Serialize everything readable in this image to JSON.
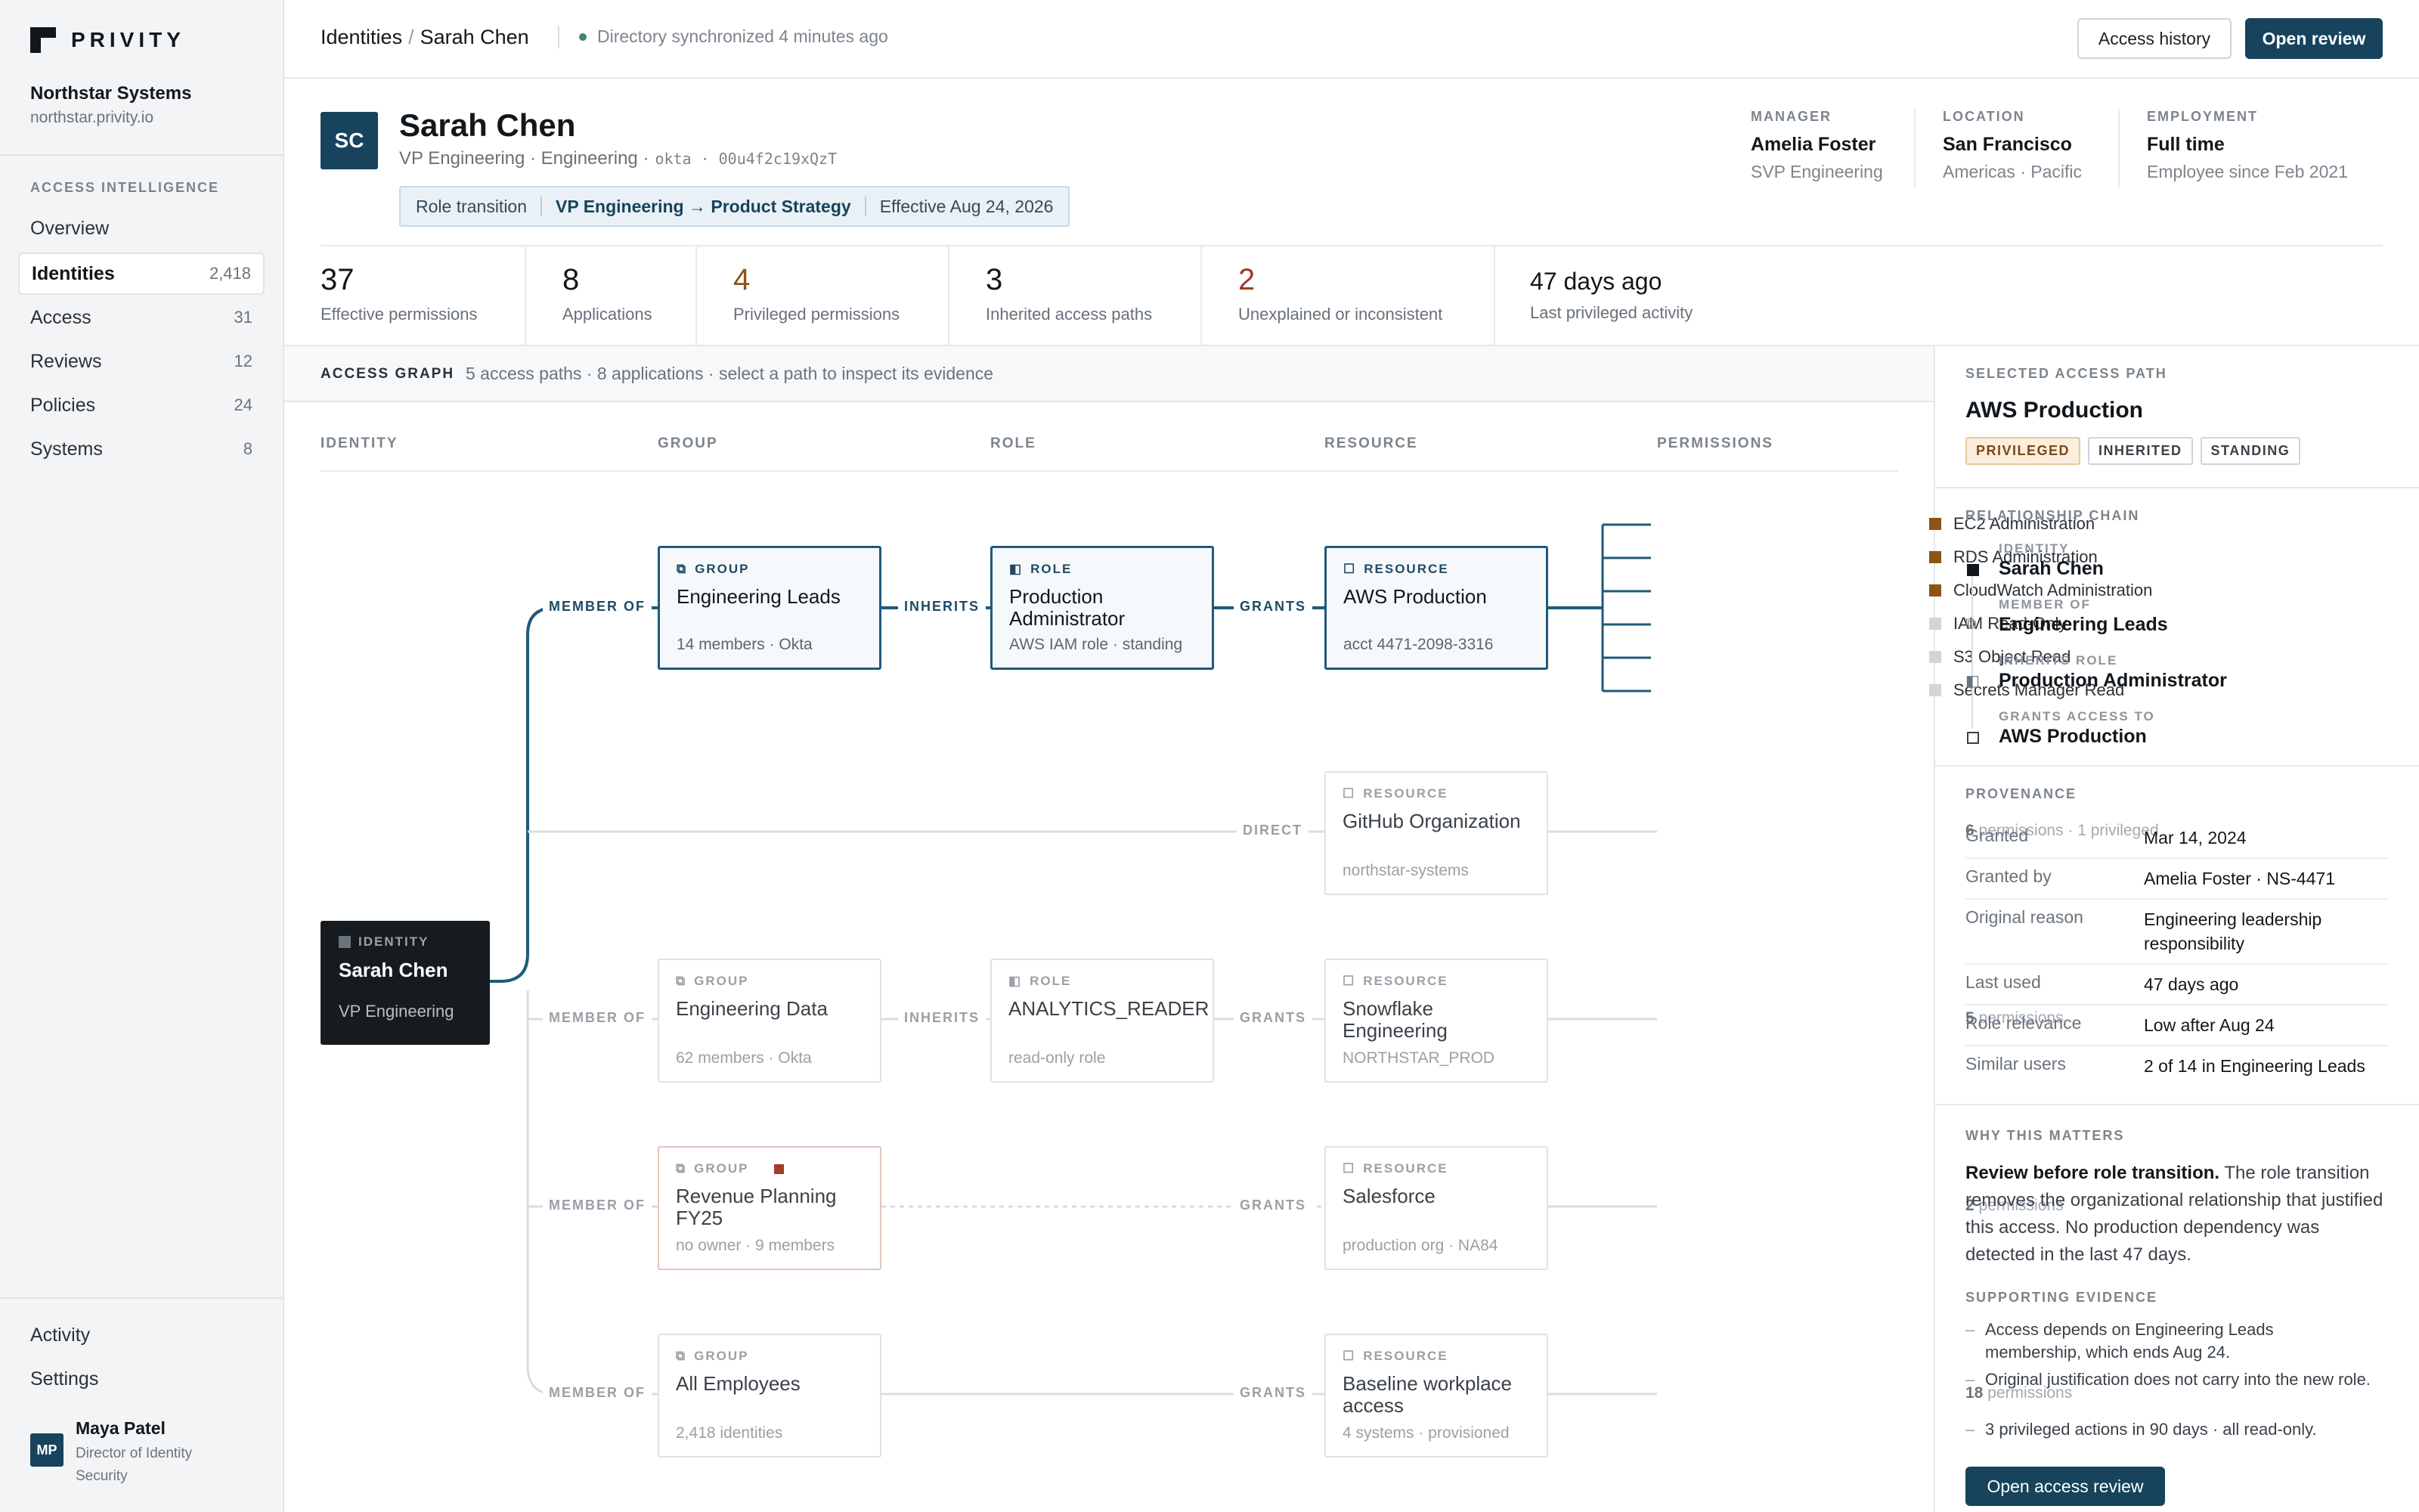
{
  "brand": {
    "name": "PRIVITY"
  },
  "org": {
    "name": "Northstar Systems",
    "domain": "northstar.privity.io"
  },
  "sidebar": {
    "section": "ACCESS INTELLIGENCE",
    "items": [
      {
        "label": "Overview",
        "count": ""
      },
      {
        "label": "Identities",
        "count": "2,418"
      },
      {
        "label": "Access",
        "count": "31"
      },
      {
        "label": "Reviews",
        "count": "12"
      },
      {
        "label": "Policies",
        "count": "24"
      },
      {
        "label": "Systems",
        "count": "8"
      }
    ],
    "bottom": [
      "Activity",
      "Settings"
    ],
    "user": {
      "initials": "MP",
      "name": "Maya Patel",
      "title": "Director of Identity Security"
    }
  },
  "header": {
    "crumb_root": "Identities",
    "crumb_sep": "/",
    "crumb_current": "Sarah Chen",
    "sync_status": "Directory synchronized 4 minutes ago",
    "access_history_label": "Access history",
    "open_review_label": "Open review"
  },
  "profile": {
    "initials": "SC",
    "name": "Sarah Chen",
    "title": "VP Engineering · Engineering ·",
    "source": "okta",
    "dot": "·",
    "id": "00u4f2c19xQzT",
    "transition_label": "Role transition",
    "transition_path": "VP Engineering → Product Strategy",
    "transition_effective": "Effective Aug 24, 2026",
    "facts": [
      {
        "key": "MANAGER",
        "value": "Amelia Foster",
        "sub": "SVP Engineering"
      },
      {
        "key": "LOCATION",
        "value": "San Francisco",
        "sub": "Americas · Pacific"
      },
      {
        "key": "EMPLOYMENT",
        "value": "Full time",
        "sub": "Employee since Feb 2021"
      }
    ]
  },
  "stats": [
    {
      "value": "37",
      "label": "Effective permissions",
      "color": "#12171c"
    },
    {
      "value": "8",
      "label": "Applications",
      "color": "#12171c"
    },
    {
      "value": "4",
      "label": "Privileged permissions",
      "color": "#8a5516"
    },
    {
      "value": "3",
      "label": "Inherited access paths",
      "color": "#12171c"
    },
    {
      "value": "2",
      "label": "Unexplained or inconsistent",
      "color": "#a33a2a"
    },
    {
      "value": "47 days ago",
      "label": "Last privileged activity",
      "color": "#12171c"
    }
  ],
  "graph": {
    "title": "ACCESS GRAPH",
    "summary": "5 access paths · 8 applications · select a path to inspect its evidence",
    "columns": [
      "IDENTITY",
      "GROUP",
      "ROLE",
      "RESOURCE",
      "PERMISSIONS"
    ],
    "identity": {
      "type": "IDENTITY",
      "name": "Sarah Chen",
      "sub": "VP Engineering"
    },
    "edges": {
      "member_of": "MEMBER OF",
      "inherits": "INHERITS",
      "grants": "GRANTS",
      "direct": "DIRECT"
    },
    "path1": {
      "group": {
        "type": "GROUP",
        "name": "Engineering Leads",
        "sub": "14 members · Okta"
      },
      "role": {
        "type": "ROLE",
        "name": "Production Administrator",
        "sub": "AWS IAM role · standing"
      },
      "resource": {
        "type": "RESOURCE",
        "name": "AWS Production",
        "sub": "acct 4471-2098-3316"
      },
      "permissions": [
        {
          "label": "EC2 Administration",
          "privileged": true
        },
        {
          "label": "RDS Administration",
          "privileged": true
        },
        {
          "label": "CloudWatch Administration",
          "privileged": true
        },
        {
          "label": "IAM Read-Only",
          "privileged": false
        },
        {
          "label": "S3 Object Read",
          "privileged": false
        },
        {
          "label": "Secrets Manager Read",
          "privileged": false
        }
      ]
    },
    "path2": {
      "resource": {
        "type": "RESOURCE",
        "name": "GitHub Organization",
        "sub": "northstar-systems"
      },
      "perm_count": "6",
      "perm_text": "permissions · 1 privileged"
    },
    "path3": {
      "group": {
        "type": "GROUP",
        "name": "Engineering Data",
        "sub": "62 members · Okta"
      },
      "role": {
        "type": "ROLE",
        "name": "ANALYTICS_READER",
        "sub": "read-only role"
      },
      "resource": {
        "type": "RESOURCE",
        "name": "Snowflake Engineering",
        "sub": "NORTHSTAR_PROD"
      },
      "perm_count": "5",
      "perm_text": "permissions"
    },
    "path4": {
      "group": {
        "type": "GROUP",
        "name": "Revenue Planning FY25",
        "sub": "no owner · 9 members"
      },
      "resource": {
        "type": "RESOURCE",
        "name": "Salesforce",
        "sub": "production org · NA84"
      },
      "perm_count": "2",
      "perm_text": "permissions"
    },
    "path5": {
      "group": {
        "type": "GROUP",
        "name": "All Employees",
        "sub": "2,418 identities"
      },
      "resource": {
        "type": "RESOURCE",
        "name": "Baseline workplace access",
        "sub": "4 systems · provisioned"
      },
      "perm_count": "18",
      "perm_text": "permissions"
    }
  },
  "detail": {
    "section": "SELECTED ACCESS PATH",
    "title": "AWS Production",
    "tags": [
      "PRIVILEGED",
      "INHERITED",
      "STANDING"
    ],
    "chain_title": "RELATIONSHIP CHAIN",
    "chain": [
      {
        "key": "IDENTITY",
        "value": "Sarah Chen"
      },
      {
        "key": "MEMBER OF",
        "value": "Engineering Leads"
      },
      {
        "key": "INHERITS ROLE",
        "value": "Production Administrator"
      },
      {
        "key": "GRANTS ACCESS TO",
        "value": "AWS Production"
      }
    ],
    "prov_title": "PROVENANCE",
    "provenance": [
      {
        "key": "Granted",
        "value": "Mar 14, 2024"
      },
      {
        "key": "Granted by",
        "value": "Amelia Foster · NS-4471"
      },
      {
        "key": "Original reason",
        "value": "Engineering leadership responsibility"
      },
      {
        "key": "Last used",
        "value": "47 days ago"
      },
      {
        "key": "Role relevance",
        "value": "Low after Aug 24"
      },
      {
        "key": "Similar users",
        "value": "2 of 14 in Engineering Leads"
      }
    ],
    "why_title": "WHY THIS MATTERS",
    "why_lead": "Review before role transition.",
    "why_body": "The role transition removes the organizational relationship that justified this access. No production dependency was detected in the last 47 days.",
    "evidence_title": "SUPPORTING EVIDENCE",
    "evidence": [
      "Access depends on Engineering Leads membership, which ends Aug 24.",
      "Original justification does not carry into the new role.",
      "3 privileged actions in 90 days · all read-only."
    ],
    "cta": "Open access review"
  },
  "colors": {
    "accent": "#17435c",
    "privileged": "#8a5516",
    "alert": "#a33a2a",
    "highlight": "#1f5a7a"
  }
}
